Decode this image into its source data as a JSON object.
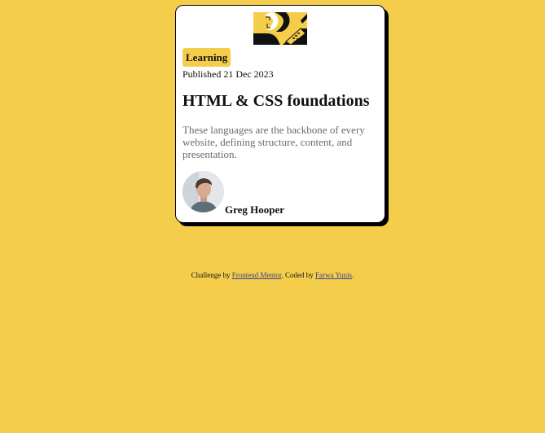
{
  "card": {
    "tag": "Learning",
    "published": "Published 21 Dec 2023",
    "title": "HTML & CSS foundations",
    "description": "These languages are the backbone of every website, defining structure, content, and presentation.",
    "author": "Greg Hooper",
    "hero_icon": "code-illustration",
    "avatar_icon": "author-avatar-photo"
  },
  "footer": {
    "prefix": "Challenge by",
    "link1": "Frontend Mentor",
    "middle": ". Coded by",
    "link2": "Farwa Yunis",
    "suffix": "."
  },
  "colors": {
    "background": "#f4ce4b",
    "card": "#ffffff",
    "text": "#111111",
    "muted": "#6b6b6b",
    "link": "#3e3e8e"
  }
}
